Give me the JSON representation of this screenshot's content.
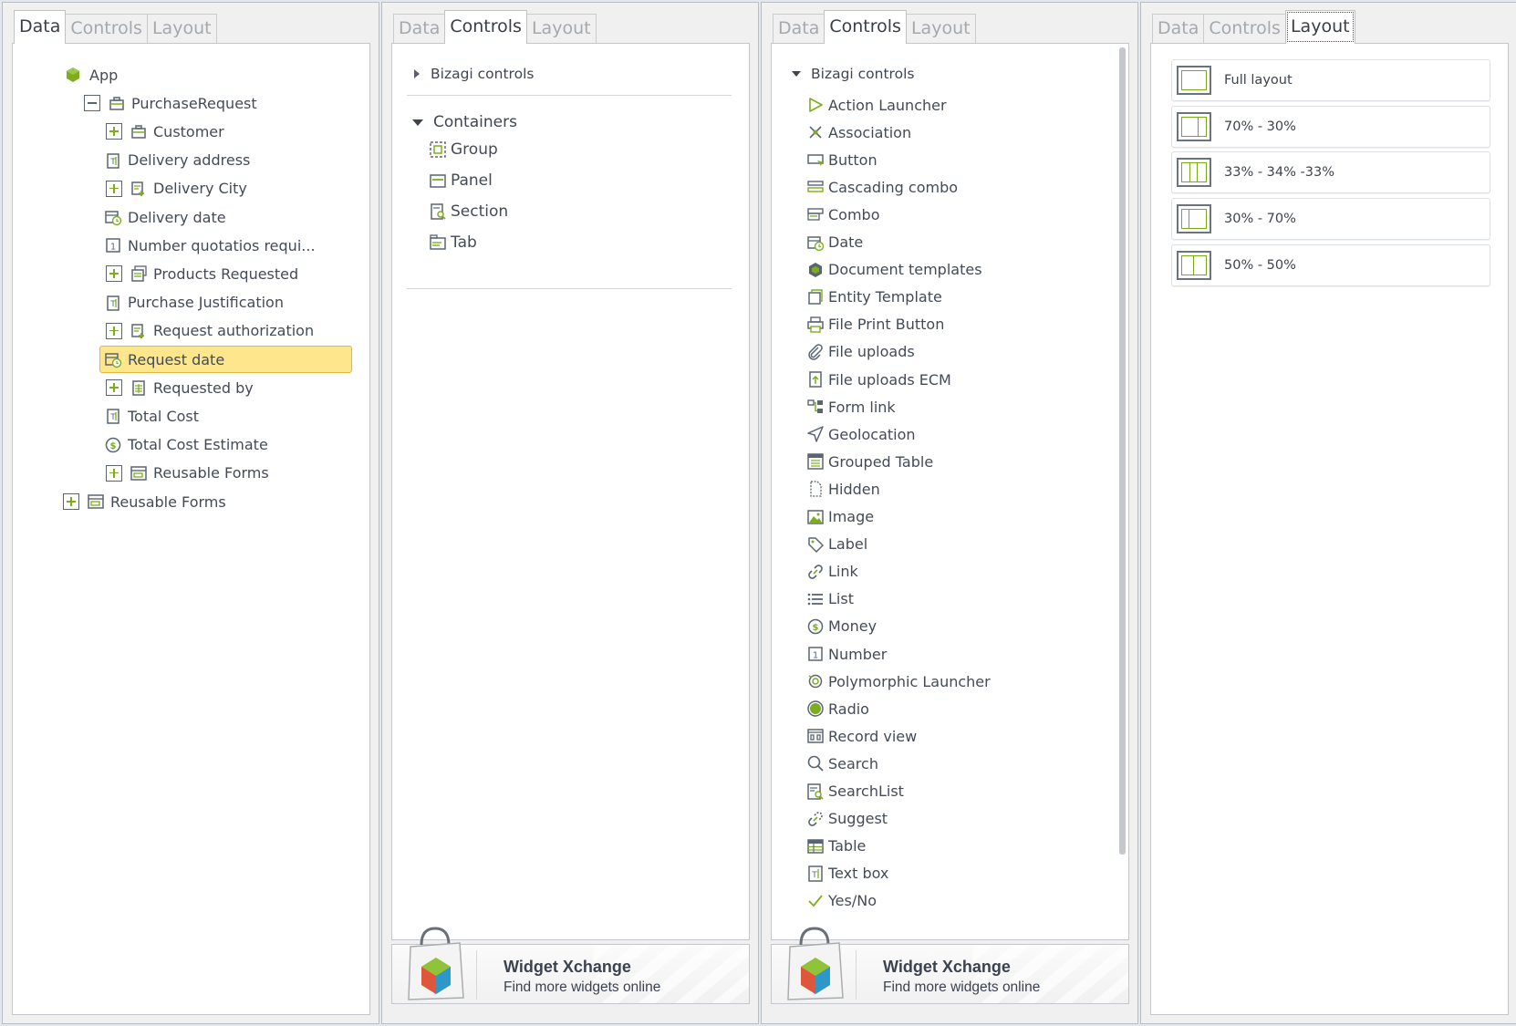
{
  "panels": {
    "tab_labels": [
      "Data",
      "Controls",
      "Layout"
    ]
  },
  "data_tree": [
    {
      "label": "App",
      "icon": "app-cube-icon",
      "expander": "none"
    },
    {
      "label": "PurchaseRequest",
      "icon": "entity-icon",
      "expander": "minus"
    },
    {
      "label": "Customer",
      "icon": "entity-icon",
      "expander": "plus"
    },
    {
      "label": "Delivery address",
      "icon": "text-attribute-icon",
      "expander": "none"
    },
    {
      "label": "Delivery City",
      "icon": "related-entity-icon",
      "expander": "plus"
    },
    {
      "label": "Delivery date",
      "icon": "date-attribute-icon",
      "expander": "none"
    },
    {
      "label": "Number quotatios requi...",
      "icon": "number-attribute-icon",
      "expander": "none"
    },
    {
      "label": "Products Requested",
      "icon": "collection-icon",
      "expander": "plus"
    },
    {
      "label": "Purchase Justification",
      "icon": "text-attribute-icon",
      "expander": "none"
    },
    {
      "label": "Request authorization",
      "icon": "related-entity-icon",
      "expander": "plus"
    },
    {
      "label": "Request date",
      "icon": "date-attribute-icon",
      "expander": "none",
      "selected": true
    },
    {
      "label": "Requested by",
      "icon": "table-entity-icon",
      "expander": "plus"
    },
    {
      "label": "Total Cost",
      "icon": "text-attribute-icon",
      "expander": "none"
    },
    {
      "label": "Total Cost Estimate",
      "icon": "money-attribute-icon",
      "expander": "none"
    },
    {
      "label": "Reusable Forms",
      "icon": "forms-icon",
      "expander": "plus"
    },
    {
      "label": "Reusable Forms",
      "icon": "forms-icon",
      "expander": "plus"
    }
  ],
  "controls_collapsed": {
    "bizagi_controls": "Bizagi controls",
    "containers_header": "Containers",
    "containers": [
      {
        "label": "Group",
        "icon": "group-icon"
      },
      {
        "label": "Panel",
        "icon": "panel-icon"
      },
      {
        "label": "Section",
        "icon": "section-icon"
      },
      {
        "label": "Tab",
        "icon": "tab-icon"
      }
    ]
  },
  "controls_expanded": {
    "bizagi_controls": "Bizagi controls",
    "items": [
      {
        "label": "Action Launcher",
        "icon": "play-icon"
      },
      {
        "label": "Association",
        "icon": "association-icon"
      },
      {
        "label": "Button",
        "icon": "button-icon"
      },
      {
        "label": "Cascading combo",
        "icon": "cascading-combo-icon"
      },
      {
        "label": "Combo",
        "icon": "combo-icon"
      },
      {
        "label": "Date",
        "icon": "date-icon"
      },
      {
        "label": "Document templates",
        "icon": "document-templates-icon"
      },
      {
        "label": "Entity Template",
        "icon": "entity-template-icon"
      },
      {
        "label": "File Print Button",
        "icon": "printer-icon"
      },
      {
        "label": "File uploads",
        "icon": "paperclip-icon"
      },
      {
        "label": "File uploads ECM",
        "icon": "upload-ecm-icon"
      },
      {
        "label": "Form link",
        "icon": "form-link-icon"
      },
      {
        "label": "Geolocation",
        "icon": "geolocation-icon"
      },
      {
        "label": "Grouped Table",
        "icon": "grouped-table-icon"
      },
      {
        "label": "Hidden",
        "icon": "hidden-icon"
      },
      {
        "label": "Image",
        "icon": "image-icon"
      },
      {
        "label": "Label",
        "icon": "label-tag-icon"
      },
      {
        "label": "Link",
        "icon": "link-icon"
      },
      {
        "label": "List",
        "icon": "list-icon"
      },
      {
        "label": "Money",
        "icon": "money-icon"
      },
      {
        "label": "Number",
        "icon": "number-icon"
      },
      {
        "label": "Polymorphic Launcher",
        "icon": "polymorphic-icon"
      },
      {
        "label": "Radio",
        "icon": "radio-icon"
      },
      {
        "label": "Record view",
        "icon": "record-view-icon"
      },
      {
        "label": "Search",
        "icon": "search-icon"
      },
      {
        "label": "SearchList",
        "icon": "searchlist-icon"
      },
      {
        "label": "Suggest",
        "icon": "suggest-icon"
      },
      {
        "label": "Table",
        "icon": "table-icon"
      },
      {
        "label": "Text box",
        "icon": "textbox-icon"
      },
      {
        "label": "Yes/No",
        "icon": "check-icon"
      }
    ]
  },
  "widget_xchange": {
    "title": "Widget Xchange",
    "subtitle": "Find more widgets online"
  },
  "layouts": [
    {
      "label": "Full layout",
      "cols": [
        1
      ]
    },
    {
      "label": "70% - 30%",
      "cols": [
        7,
        3
      ]
    },
    {
      "label": "33% - 34% -33%",
      "cols": [
        1,
        1,
        1
      ]
    },
    {
      "label": "30% - 70%",
      "cols": [
        3,
        7
      ]
    },
    {
      "label": "50% - 50%",
      "cols": [
        1,
        1
      ]
    }
  ],
  "colors": {
    "accent_green": "#7dad1f",
    "selection": "#fde68c",
    "icon_gray": "#5a6572"
  }
}
